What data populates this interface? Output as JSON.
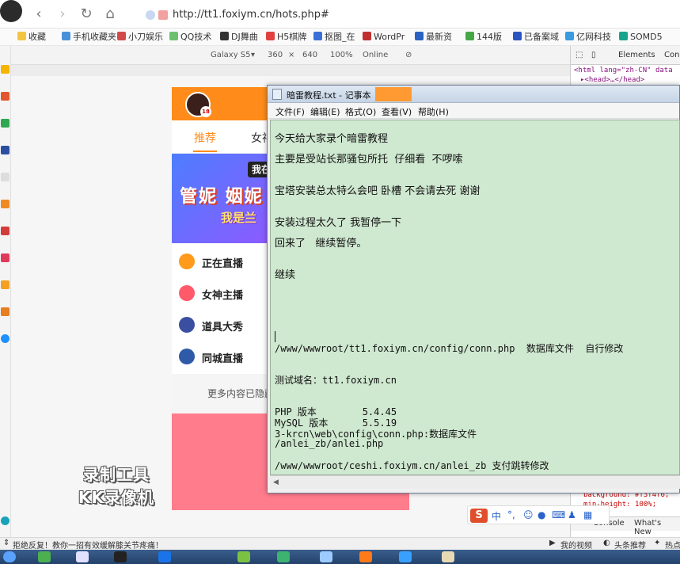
{
  "browser": {
    "url": "http://tt1.foxiym.cn/hots.php#",
    "bookmarks": [
      "收藏",
      "手机收藏夹",
      "小刀娱乐",
      "QQ技术",
      "DJ舞曲",
      "H5棋牌",
      "抠图_在",
      "WordPr",
      "最新资",
      "144版",
      "已备案域",
      "亿网科技",
      "SOMD5"
    ]
  },
  "emulation": {
    "device": "Galaxy S5",
    "width": "360",
    "times": "×",
    "height": "640",
    "zoom": "100%",
    "network": "Online"
  },
  "devtools": {
    "tab_elements": "Elements",
    "tab_console_short": "Con",
    "code_lines": [
      "<html lang=\"zh-CN\" data",
      "▸<head>…</head>"
    ],
    "css_lines": [
      "background: #f3f4f6;",
      "min-height: 100%;"
    ],
    "bottom_tabs": [
      "Console",
      "What's New"
    ]
  },
  "phone": {
    "logo_badge": "18",
    "tabs": [
      "推荐",
      "女神"
    ],
    "banner_tag": "我在",
    "banner_big": "管妮 姻妮",
    "banner_small": "我是兰",
    "items": [
      {
        "label": "正在直播",
        "color": "#ff9a1a"
      },
      {
        "label": "女神主播",
        "color": "#ff5a6a"
      },
      {
        "label": "道具大秀",
        "color": "#3b4fa0"
      },
      {
        "label": "同城直播",
        "color": "#2f5aa8"
      }
    ],
    "more_text": "更多内容已隐藏"
  },
  "watermark": {
    "line1": "录制工具",
    "line2": "KK录像机"
  },
  "notepad": {
    "title": "暗雷教程.txt - 记事本",
    "menus": [
      "文件(F)",
      "编辑(E)",
      "格式(O)",
      "查看(V)",
      "帮助(H)"
    ],
    "lines": {
      "l1": "今天给大家录个暗雷教程",
      "l2": "主要是受站长那骚包所托  仔细看  不啰嗦",
      "l3": "宝塔安装总太特么会吧 卧槽 不会请去死 谢谢",
      "l4": "安装过程太久了 我暂停一下",
      "l5": "回来了   继续暂停。",
      "l6": "继续",
      "l7": "/www/wwwroot/tt1.foxiym.cn/config/conn.php  数据库文件  自行修改",
      "l8": "测试域名：tt1.foxiym.cn",
      "l9": "PHP 版本        5.4.45",
      "l10": "MySQL 版本      5.5.19",
      "l11": "3-krcn\\web\\config\\conn.php:数据库文件",
      "l12": "/anlei_zb/anlei.php",
      "l13": "/www/wwwroot/ceshi.foxiym.cn/anlei_zb 支付跳转修改"
    }
  },
  "ime": {
    "logo": "S",
    "lang": "中",
    "punct": "°,"
  },
  "status": {
    "left": "拒绝反复！教你一招有效缓解膝关节疼痛！",
    "video": "我的视频",
    "headline": "头条推荐",
    "hot": "热点"
  }
}
